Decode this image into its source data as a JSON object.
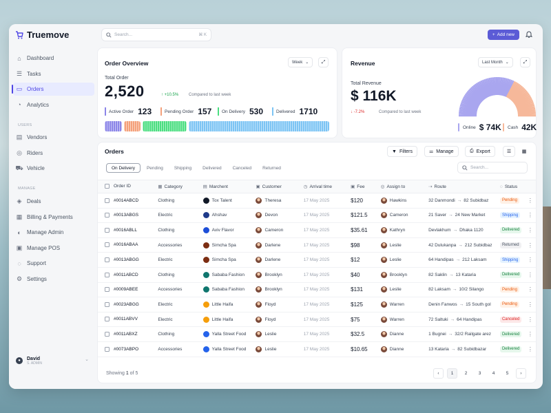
{
  "app": {
    "name": "Truemove"
  },
  "topbar": {
    "search_placeholder": "Search...",
    "search_shortcut": "⌘ K",
    "add_label": "Add new"
  },
  "sidebar": {
    "items": [
      {
        "label": "Dashboard",
        "icon": "⌂"
      },
      {
        "label": "Tasks",
        "icon": "☰"
      },
      {
        "label": "Orders",
        "icon": "▭",
        "active": true
      },
      {
        "label": "Analytics",
        "icon": "◔"
      }
    ],
    "users_label": "USERS",
    "users_items": [
      {
        "label": "Vendors",
        "icon": "▤"
      },
      {
        "label": "Riders",
        "icon": "◎"
      },
      {
        "label": "Vehicle",
        "icon": "⛟"
      }
    ],
    "manage_label": "MANAGE",
    "manage_items": [
      {
        "label": "Deals",
        "icon": "◈"
      },
      {
        "label": "Billing & Payments",
        "icon": "▦"
      },
      {
        "label": "Manage Admin",
        "icon": "◐"
      },
      {
        "label": "Manage POS",
        "icon": "▣"
      },
      {
        "label": "Support",
        "icon": "◌"
      },
      {
        "label": "Settings",
        "icon": "⚙"
      }
    ],
    "user": {
      "name": "David",
      "role": "S. ADMIN"
    }
  },
  "overview": {
    "title": "Order Overview",
    "period": "Week",
    "total_label": "Total Order",
    "total_value": "2,520",
    "change": "+10.5%",
    "compare": "Compared to last week",
    "stats": [
      {
        "label": "Active Order",
        "value": "123",
        "color": "#8b85e8"
      },
      {
        "label": "Pending Order",
        "value": "157",
        "color": "#f4a07a"
      },
      {
        "label": "On Delivery",
        "value": "530",
        "color": "#4ade80"
      },
      {
        "label": "Delivered",
        "value": "1710",
        "color": "#7cc4f4"
      }
    ]
  },
  "revenue": {
    "title": "Revenue",
    "period": "Last Month",
    "total_label": "Total Revenue",
    "total_value": "$ 116K",
    "change": "-7.2%",
    "compare": "Compared to last week",
    "online_label": "Online",
    "online_value": "$ 74K",
    "online_color": "#a9a6ef",
    "online_share": 0.64,
    "cash_label": "Cash",
    "cash_value": "42K",
    "cash_color": "#f6b89a"
  },
  "orders": {
    "title": "Orders",
    "filters_label": "Filters",
    "manage_label": "Manage",
    "export_label": "Export",
    "tabs": [
      "On Delivery",
      "Pending",
      "Shipping",
      "Delivered",
      "Canceled",
      "Returned"
    ],
    "search_placeholder": "Search...",
    "columns": [
      "Order ID",
      "Category",
      "Marchent",
      "Customer",
      "Arrival time",
      "Fee",
      "Assign to",
      "Route",
      "Status"
    ],
    "rows": [
      {
        "id": "#0014ABCD",
        "category": "Clothing",
        "merchant": "Tox Talent",
        "mcolor": "#111827",
        "customer": "Theresa",
        "arrival": "17 May 2025",
        "fee": "$120",
        "assign": "Hawkins",
        "from": "32 Danmondi",
        "to": "82 Subidbaz",
        "status": "Pending",
        "s": "pending"
      },
      {
        "id": "#0013ABGS",
        "category": "Electric",
        "merchant": "Ahshav",
        "mcolor": "#1e3a8a",
        "customer": "Devon",
        "arrival": "17 May 2025",
        "fee": "$121.5",
        "assign": "Cameron",
        "from": "21 Saver",
        "to": "24 New Market",
        "status": "Shipping",
        "s": "shipping"
      },
      {
        "id": "#0016ABLL",
        "category": "Clothing",
        "merchant": "Aviv Flavor",
        "mcolor": "#1d4ed8",
        "customer": "Cameron",
        "arrival": "17 May 2025",
        "fee": "$35.61",
        "assign": "Kathryn",
        "from": "Devlakhum",
        "to": "Dhaka 1120",
        "status": "Delivered",
        "s": "delivered"
      },
      {
        "id": "#0016ABAA",
        "category": "Accessories",
        "merchant": "Simcha Spa",
        "mcolor": "#7c2d12",
        "customer": "Darlene",
        "arrival": "17 May 2025",
        "fee": "$98",
        "assign": "Leslie",
        "from": "42 Dulukanpa",
        "to": "212 Subidbaz",
        "status": "Returned",
        "s": "returned"
      },
      {
        "id": "#0013ABGG",
        "category": "Electric",
        "merchant": "Simcha Spa",
        "mcolor": "#7c2d12",
        "customer": "Darlene",
        "arrival": "17 May 2025",
        "fee": "$12",
        "assign": "Leslie",
        "from": "64 Handipas",
        "to": "212 Laksam",
        "status": "Shipping",
        "s": "shipping"
      },
      {
        "id": "#0011ABCD",
        "category": "Clothing",
        "merchant": "Sababa Fashion",
        "mcolor": "#0f766e",
        "customer": "Brooklyn",
        "arrival": "17 May 2025",
        "fee": "$40",
        "assign": "Brooklyn",
        "from": "82 Saklin",
        "to": "13 Kataria",
        "status": "Delivered",
        "s": "delivered"
      },
      {
        "id": "#0009ABEE",
        "category": "Accessories",
        "merchant": "Sababa Fashion",
        "mcolor": "#0f766e",
        "customer": "Brooklyn",
        "arrival": "17 May 2025",
        "fee": "$131",
        "assign": "Leslie",
        "from": "82 Laksam",
        "to": "10/2 Silango",
        "status": "Pending",
        "s": "pending"
      },
      {
        "id": "#0023ABGG",
        "category": "Electric",
        "merchant": "Little Haifa",
        "mcolor": "#f59e0b",
        "customer": "Floyd",
        "arrival": "17 May 2025",
        "fee": "$125",
        "assign": "Warren",
        "from": "Denin Fanwos",
        "to": "15 South gol",
        "status": "Pending",
        "s": "pending"
      },
      {
        "id": "#0011ABVV",
        "category": "Electric",
        "merchant": "Little Haifa",
        "mcolor": "#f59e0b",
        "customer": "Floyd",
        "arrival": "17 May 2025",
        "fee": "$75",
        "assign": "Warren",
        "from": "72 Saltuki",
        "to": "64 Handipas",
        "status": "Canceled",
        "s": "canceled"
      },
      {
        "id": "#0011ABXZ",
        "category": "Clothing",
        "merchant": "Yalla Street Food",
        "mcolor": "#2563eb",
        "customer": "Leslie",
        "arrival": "17 May 2025",
        "fee": "$32.5",
        "assign": "Dianne",
        "from": "1 Bugnei",
        "to": "32/2 Railgate arez",
        "status": "Delivered",
        "s": "delivered"
      },
      {
        "id": "#0073ABPO",
        "category": "Accessories",
        "merchant": "Yalla Street Food",
        "mcolor": "#2563eb",
        "customer": "Leslie",
        "arrival": "17 May 2025",
        "fee": "$10.65",
        "assign": "Dianne",
        "from": "13 Kataria",
        "to": "82 Subidbazar",
        "status": "Delivered",
        "s": "delivered"
      }
    ],
    "showing_prefix": "Showing",
    "showing_current": "1",
    "showing_of": "of",
    "showing_total": "5",
    "pages": [
      "1",
      "2",
      "3",
      "4",
      "5"
    ]
  }
}
